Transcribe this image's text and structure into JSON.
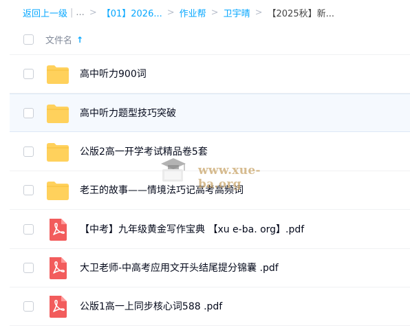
{
  "breadcrumb": {
    "back": "返回上一级",
    "bar": "|",
    "ellipsis": "...",
    "sep": ">",
    "items": [
      "【01】2026...",
      "作业帮",
      "卫宇晴"
    ],
    "current": "【2025秋】新..."
  },
  "header": {
    "column_label": "文件名",
    "sort_arrow": "↑"
  },
  "files": [
    {
      "name": "高中听力900词",
      "type": "folder"
    },
    {
      "name": "高中听力题型技巧突破",
      "type": "folder"
    },
    {
      "name": "公版2高一开学考试精品卷5套",
      "type": "folder"
    },
    {
      "name": "老王的故事——情境法巧记高考高频词",
      "type": "folder"
    },
    {
      "name": "【中考】九年级黄金写作宝典 【xu e-ba. org】.pdf",
      "type": "pdf"
    },
    {
      "name": "大卫老师-中高考应用文开头结尾提分锦囊 .pdf",
      "type": "pdf"
    },
    {
      "name": "公版1高一上同步核心词588 .pdf",
      "type": "pdf"
    }
  ],
  "watermark": {
    "text": "www.xue-ba.org"
  },
  "colors": {
    "accent": "#06a7ff",
    "folder": "#ffd15c",
    "pdf": "#f25c5c"
  }
}
